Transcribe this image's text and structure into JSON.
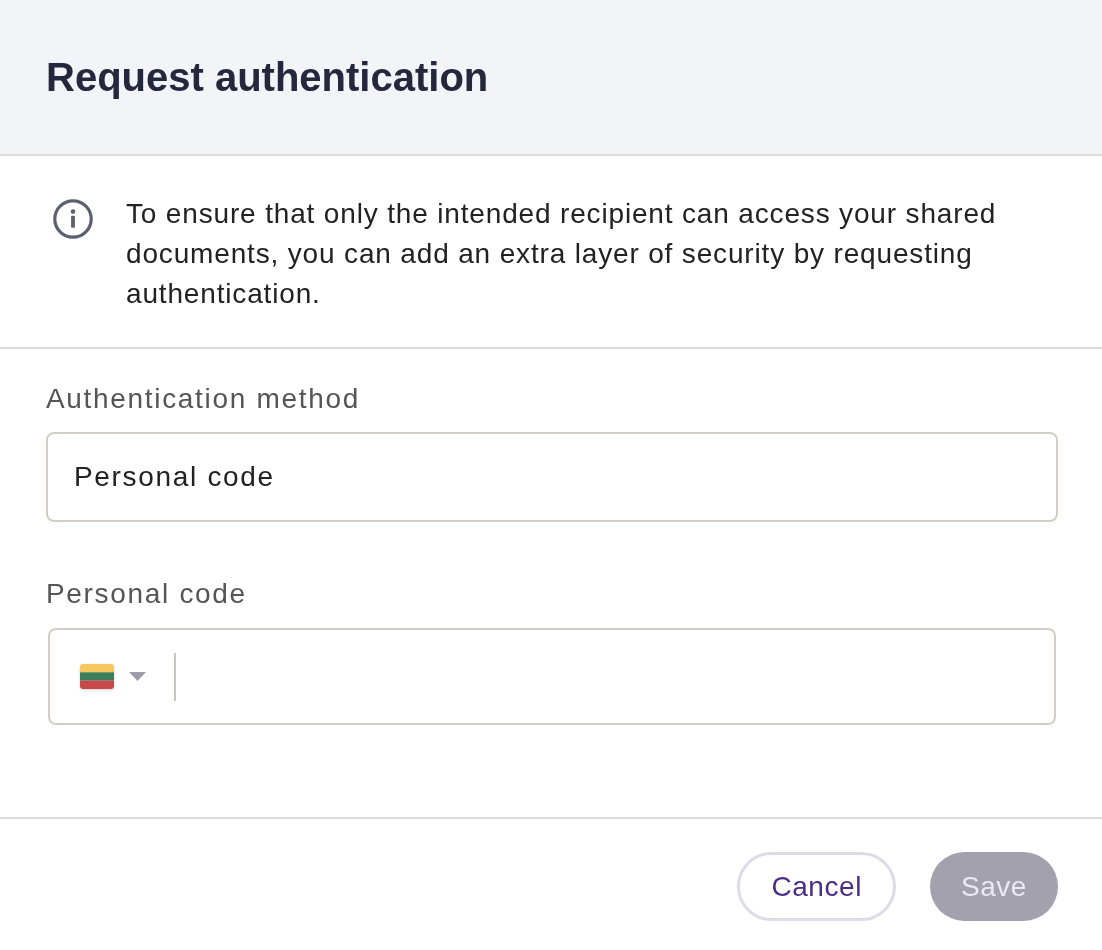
{
  "dialog": {
    "title": "Request authentication"
  },
  "info": {
    "text": "To ensure that only the intended recipient can access your shared documents, you can add an extra layer of security by requesting authentication."
  },
  "fields": [
    {
      "kind": "text",
      "label": "Authentication method",
      "value": "Personal code"
    },
    {
      "kind": "phone",
      "label": "Personal code"
    }
  ],
  "buttons": [
    {
      "label": "Cancel",
      "kind": "secondary",
      "disabled": false
    },
    {
      "label": "Save",
      "kind": "primary",
      "disabled": true
    }
  ]
}
